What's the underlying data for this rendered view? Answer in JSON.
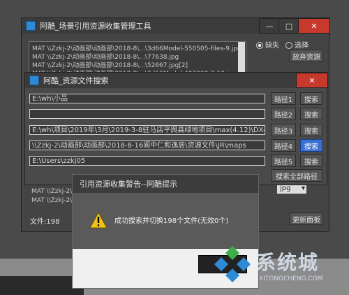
{
  "main_window": {
    "title": "阿酷_场景引用资源收集管理工具",
    "list_lines": [
      "MAT  \\\\Zzkj-2\\动画部\\动画部\\2018-8\\...\\3d66Model-550505-files-9.jpg",
      "MAT  \\\\Zzkj-2\\动画部\\动画部\\2018-8\\...\\77638.jpg",
      "MAT  \\\\Zzkj-2\\动画部\\动画部\\2018-8\\...\\52667.jpg[2]",
      "MAT  \\\\Zzkj-2\\动画部\\动画部\\2018-8\\...\\3d66Model-407330-3-10.jpg"
    ],
    "radio_missing": "缺失",
    "radio_select": "选择",
    "discard_button": "放弃资源",
    "bottom_list_lines": [
      "MAT  \\\\Zzkj-2\\动画部\\",
      "MAT  \\\\Zzkj-2\\动画部\\"
    ],
    "file_count": "文件:198",
    "format_value": "jpg",
    "refresh_button": "更新面板"
  },
  "search_window": {
    "title": "阿酷_资源文件搜索",
    "paths": [
      {
        "value": "E:\\wh\\小品",
        "label": "路径1",
        "search": "搜索"
      },
      {
        "value": "",
        "label": "路径2",
        "search": "搜索"
      },
      {
        "value": "E:\\wh\\项目\\2019年\\3月\\2019-3-8驻马店平舆县绿地项目\\max(4.12)\\DX-03",
        "label": "路径3",
        "search": "搜索"
      },
      {
        "value": "\\\\Zzkj-2\\动画部\\动画部\\2018-8-16阆中仁和逸居\\资源文件\\JR\\maps",
        "label": "路径4",
        "search": "搜索"
      },
      {
        "value": "E:\\Users\\zzkj05",
        "label": "路径5",
        "search": "搜索"
      }
    ],
    "search_all": "搜索全部路径"
  },
  "dialog": {
    "title": "引用资源收集警告--阿酷提示",
    "message": "成功搜索并切换198个文件(无效0个)"
  },
  "watermark": {
    "text": "系统城",
    "sub": "XITONGCHENG.COM"
  }
}
